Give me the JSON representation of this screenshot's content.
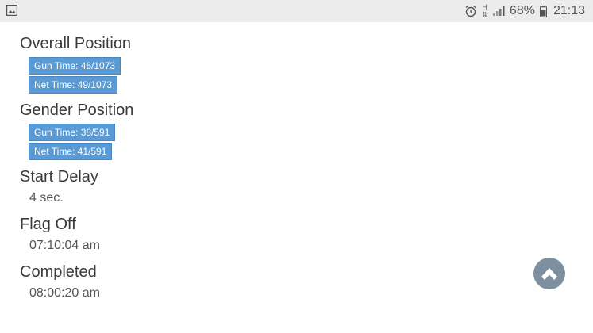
{
  "status_bar": {
    "left_icon": "image-icon",
    "icons": [
      "alarm-icon",
      "hplus-icon",
      "signal-icon",
      "battery-icon"
    ],
    "network_label": "H",
    "battery": "68%",
    "time": "21:13"
  },
  "results": {
    "overall_position": {
      "title": "Overall Position",
      "gun_time": "Gun Time: 46/1073",
      "net_time": "Net Time: 49/1073"
    },
    "gender_position": {
      "title": "Gender Position",
      "gun_time": "Gun Time: 38/591",
      "net_time": "Net Time: 41/591"
    },
    "start_delay": {
      "title": "Start Delay",
      "value": "4 sec."
    },
    "flag_off": {
      "title": "Flag Off",
      "value": "07:10:04 am"
    },
    "completed": {
      "title": "Completed",
      "value": "08:00:20 am"
    }
  },
  "scroll_top_button": {
    "icon": "chevron-up-icon"
  },
  "colors": {
    "badge": "#5b9bd5",
    "scroll_button": "#7e8fa0"
  }
}
